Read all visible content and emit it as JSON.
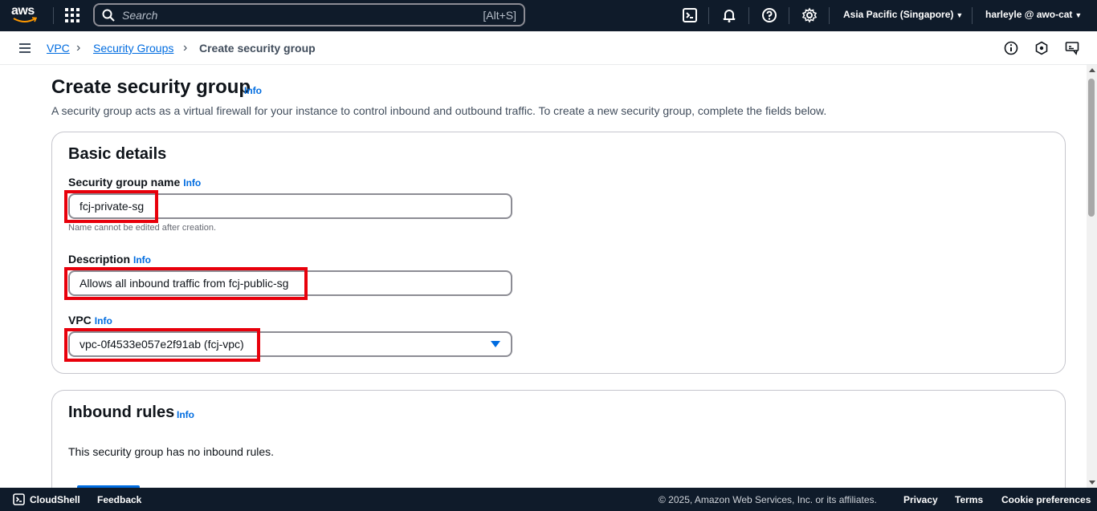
{
  "topnav": {
    "logo_text": "aws",
    "search_placeholder": "Search",
    "search_shortcut": "[Alt+S]",
    "region": "Asia Pacific (Singapore)",
    "user": "harleyle @ awo-cat",
    "icons": [
      "app-grid-icon",
      "search-icon",
      "cloudshell-icon",
      "bell-icon",
      "help-icon",
      "gear-icon"
    ]
  },
  "breadcrumb": {
    "items": [
      "VPC",
      "Security Groups",
      "Create security group"
    ]
  },
  "page": {
    "title": "Create security group",
    "info": "Info",
    "description": "A security group acts as a virtual firewall for your instance to control inbound and outbound traffic. To create a new security group, complete the fields below."
  },
  "basic_details": {
    "title": "Basic details",
    "name_label": "Security group name",
    "name_value": "fcj-private-sg",
    "name_hint": "Name cannot be edited after creation.",
    "description_label": "Description",
    "description_value": "Allows all inbound traffic from fcj-public-sg",
    "vpc_label": "VPC",
    "vpc_value": "vpc-0f4533e057e2f91ab (fcj-vpc)"
  },
  "inbound_rules": {
    "title": "Inbound rules",
    "empty_text": "This security group has no inbound rules."
  },
  "footer": {
    "cloudshell": "CloudShell",
    "feedback": "Feedback",
    "copyright": "© 2025, Amazon Web Services, Inc. or its affiliates.",
    "privacy": "Privacy",
    "terms": "Terms",
    "cookies": "Cookie preferences"
  },
  "colors": {
    "nav_bg": "#0f1b2a",
    "link": "#006ce0",
    "highlight": "#e8000b"
  }
}
